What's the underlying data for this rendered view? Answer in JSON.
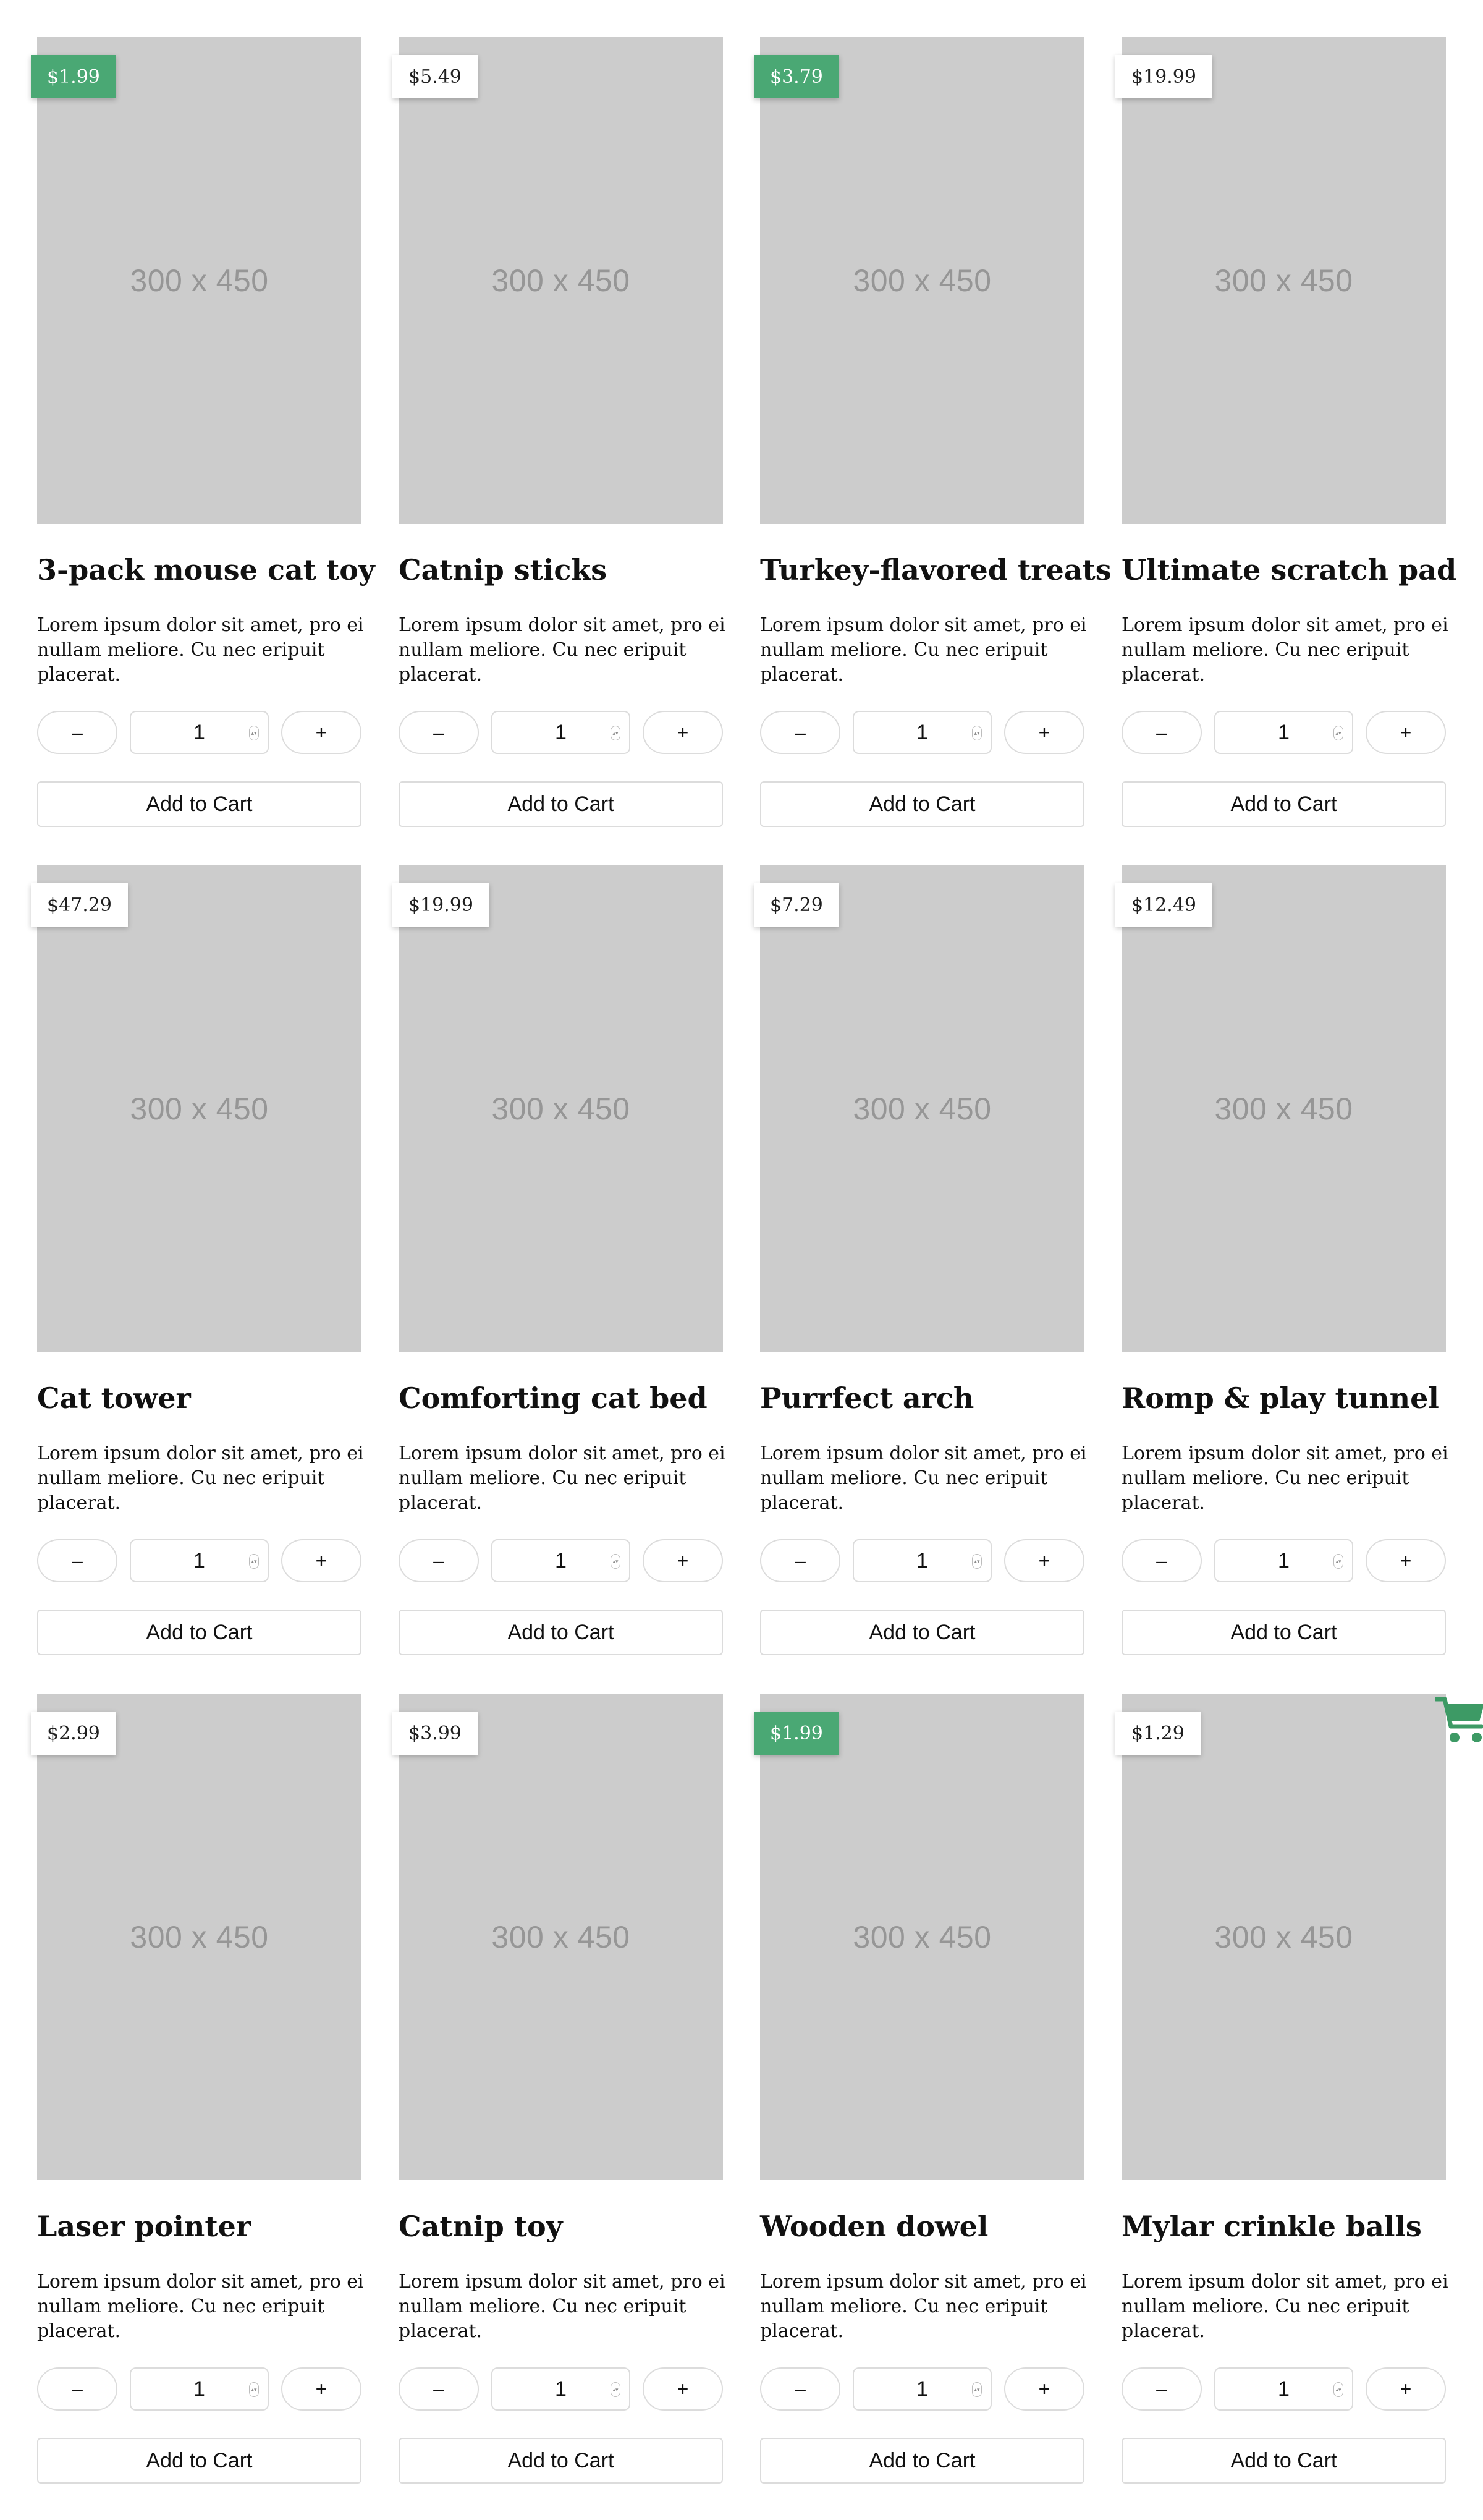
{
  "products": [
    {
      "price": "$1.99",
      "sale": true,
      "image_label": "300 x 450",
      "name": "3-pack mouse cat toy",
      "description": "Lorem ipsum dolor sit amet, pro ei nullam meliore. Cu nec eripuit placerat.",
      "minus": "–",
      "quantity": "1",
      "plus": "+",
      "button": "Add to Cart"
    },
    {
      "price": "$5.49",
      "sale": false,
      "image_label": "300 x 450",
      "name": "Catnip sticks",
      "description": "Lorem ipsum dolor sit amet, pro ei nullam meliore. Cu nec eripuit placerat.",
      "minus": "–",
      "quantity": "1",
      "plus": "+",
      "button": "Add to Cart"
    },
    {
      "price": "$3.79",
      "sale": true,
      "image_label": "300 x 450",
      "name": "Turkey-flavored treats",
      "description": "Lorem ipsum dolor sit amet, pro ei nullam meliore. Cu nec eripuit placerat.",
      "minus": "–",
      "quantity": "1",
      "plus": "+",
      "button": "Add to Cart"
    },
    {
      "price": "$19.99",
      "sale": false,
      "image_label": "300 x 450",
      "name": "Ultimate scratch pad",
      "description": "Lorem ipsum dolor sit amet, pro ei nullam meliore. Cu nec eripuit placerat.",
      "minus": "–",
      "quantity": "1",
      "plus": "+",
      "button": "Add to Cart"
    },
    {
      "price": "$47.29",
      "sale": false,
      "image_label": "300 x 450",
      "name": "Cat tower",
      "description": "Lorem ipsum dolor sit amet, pro ei nullam meliore. Cu nec eripuit placerat.",
      "minus": "–",
      "quantity": "1",
      "plus": "+",
      "button": "Add to Cart"
    },
    {
      "price": "$19.99",
      "sale": false,
      "image_label": "300 x 450",
      "name": "Comforting cat bed",
      "description": "Lorem ipsum dolor sit amet, pro ei nullam meliore. Cu nec eripuit placerat.",
      "minus": "–",
      "quantity": "1",
      "plus": "+",
      "button": "Add to Cart"
    },
    {
      "price": "$7.29",
      "sale": false,
      "image_label": "300 x 450",
      "name": "Purrfect arch",
      "description": "Lorem ipsum dolor sit amet, pro ei nullam meliore. Cu nec eripuit placerat.",
      "minus": "–",
      "quantity": "1",
      "plus": "+",
      "button": "Add to Cart"
    },
    {
      "price": "$12.49",
      "sale": false,
      "image_label": "300 x 450",
      "name": "Romp & play tunnel",
      "description": "Lorem ipsum dolor sit amet, pro ei nullam meliore. Cu nec eripuit placerat.",
      "minus": "–",
      "quantity": "1",
      "plus": "+",
      "button": "Add to Cart"
    },
    {
      "price": "$2.99",
      "sale": false,
      "image_label": "300 x 450",
      "name": "Laser pointer",
      "description": "Lorem ipsum dolor sit amet, pro ei nullam meliore. Cu nec eripuit placerat.",
      "minus": "–",
      "quantity": "1",
      "plus": "+",
      "button": "Add to Cart"
    },
    {
      "price": "$3.99",
      "sale": false,
      "image_label": "300 x 450",
      "name": "Catnip toy",
      "description": "Lorem ipsum dolor sit amet, pro ei nullam meliore. Cu nec eripuit placerat.",
      "minus": "–",
      "quantity": "1",
      "plus": "+",
      "button": "Add to Cart"
    },
    {
      "price": "$1.99",
      "sale": true,
      "image_label": "300 x 450",
      "name": "Wooden dowel",
      "description": "Lorem ipsum dolor sit amet, pro ei nullam meliore. Cu nec eripuit placerat.",
      "minus": "–",
      "quantity": "1",
      "plus": "+",
      "button": "Add to Cart"
    },
    {
      "price": "$1.29",
      "sale": false,
      "image_label": "300 x 450",
      "name": "Mylar crinkle balls",
      "description": "Lorem ipsum dolor sit amet, pro ei nullam meliore. Cu nec eripuit placerat.",
      "minus": "–",
      "quantity": "1",
      "plus": "+",
      "button": "Add to Cart"
    }
  ],
  "floating_cart": {
    "icon": "shopping-cart-icon"
  },
  "colors": {
    "sale_badge": "#4aa874",
    "image_placeholder": "#cccccc",
    "placeholder_text": "#969696",
    "border": "#dcdcdc",
    "cart_icon": "#3d9a65"
  }
}
